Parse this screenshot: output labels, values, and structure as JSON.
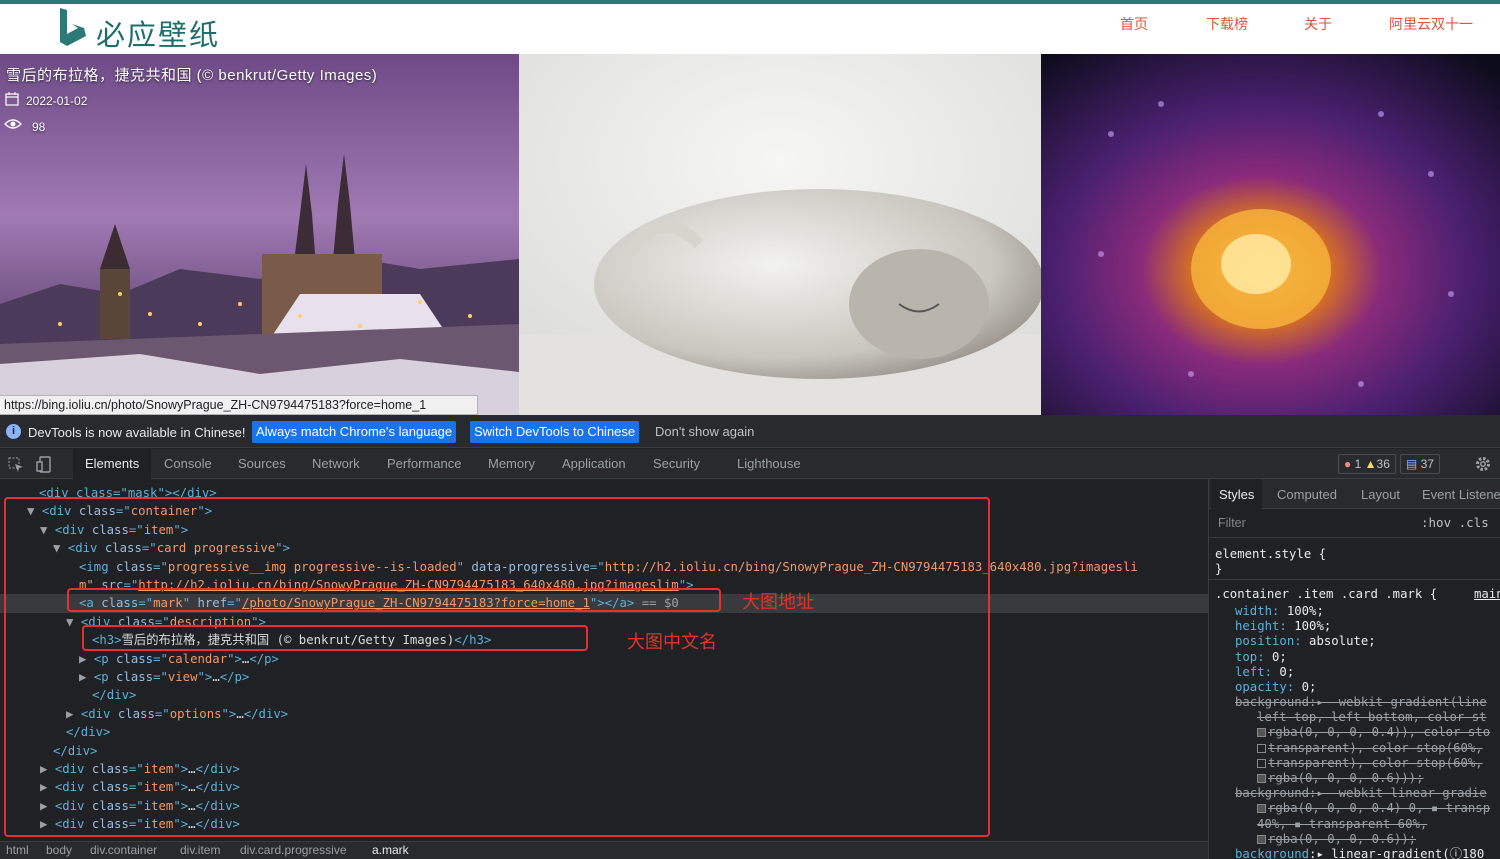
{
  "site": {
    "logo_text": "必应壁纸",
    "nav": [
      "首页",
      "下载榜",
      "关于",
      "阿里云双十一"
    ],
    "accent_color": "#2b7a78",
    "nav_color": "#e0533c"
  },
  "card": {
    "title": "雪后的布拉格，捷克共和国 (© benkrut/Getty Images)",
    "date": "2022-01-02",
    "views": "98",
    "calendar_icon": "calendar-icon",
    "eye_icon": "eye-icon"
  },
  "status_url": "https://bing.ioliu.cn/photo/SnowyPrague_ZH-CN9794475183?force=home_1",
  "devtools": {
    "infobar": {
      "text": "DevTools is now available in Chinese!",
      "btn_match": "Always match Chrome's language",
      "btn_switch": "Switch DevTools to Chinese",
      "btn_dismiss": "Don't show again"
    },
    "tabs": [
      "Elements",
      "Console",
      "Sources",
      "Network",
      "Performance",
      "Memory",
      "Application",
      "Security",
      "Lighthouse"
    ],
    "counts": {
      "errors": "1",
      "warnings": "36",
      "messages": "37"
    },
    "annotations": {
      "big_url": "大图地址",
      "big_name": "大图中文名"
    },
    "dom": {
      "l1": "<div class=\"mask\"></div>",
      "container_tag": "div",
      "container_class": "container",
      "item_class": "item",
      "card_class": "card progressive",
      "img_class": "progressive__img progressive--is-loaded",
      "img_data_progressive_1": "http://h2.ioliu.cn/bing/SnowyPrague_ZH-CN9794475183_640x480.jpg?imagesli",
      "img_data_progressive_2": "m\"",
      "img_src": "http://h2.ioliu.cn/bing/SnowyPrague_ZH-CN9794475183_640x480.jpg?imageslim",
      "a_class": "mark",
      "a_href": "/photo/SnowyPrague_ZH-CN9794475183?force=home_1",
      "a_suffix": " == $0",
      "desc_class": "description",
      "h3_text": "雪后的布拉格，捷克共和国 (© benkrut/Getty Images)",
      "calendar_class": "calendar",
      "view_class": "view",
      "options_class": "options",
      "ellipsis": "…"
    },
    "breadcrumb": [
      "html",
      "body",
      "div.container",
      "div.item",
      "div.card.progressive",
      "a.mark"
    ],
    "styles": {
      "tabs": [
        "Styles",
        "Computed",
        "Layout",
        "Event Listene"
      ],
      "filter_placeholder": "Filter",
      "hov_cls": ":hov  .cls",
      "element_style": "element.style {",
      "close": "}",
      "rule_selector": ".container .item .card .mark {",
      "rule_source": "main",
      "props": [
        {
          "n": "width",
          "v": "100%;"
        },
        {
          "n": "height",
          "v": "100%;"
        },
        {
          "n": "position",
          "v": "absolute;"
        },
        {
          "n": "top",
          "v": "0;"
        },
        {
          "n": "left",
          "v": "0;"
        },
        {
          "n": "opacity",
          "v": "0;"
        }
      ],
      "strike_lines": [
        "background:▸ -webkit-gradient(line",
        "left top, left bottom, color-st",
        "rgba(0, 0, 0, 0.4)), color-sto",
        "transparent), color-stop(60%,",
        "transparent), color-stop(60%,",
        "rgba(0, 0, 0, 0.6)));",
        "background:▸ -webkit-linear-gradie",
        "rgba(0, 0, 0, 0.4) 0, ▪ transp",
        "40%, ▪ transparent 60%,",
        "rgba(0, 0, 0, 0.6));"
      ],
      "last_line": "background:▸ linear-gradient(ⓘ180"
    }
  }
}
